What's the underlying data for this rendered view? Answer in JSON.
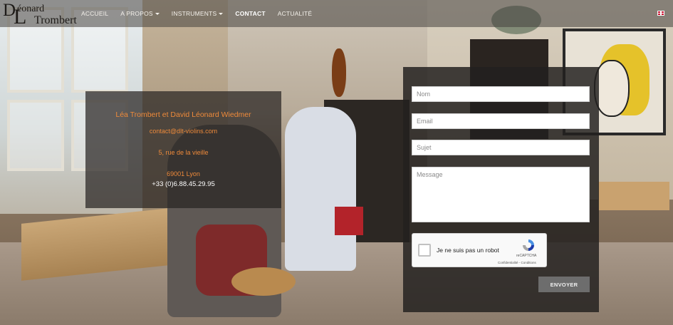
{
  "brand": {
    "logo_initial_d": "D",
    "logo_initial_l": "L",
    "logo_word_1": "éonard",
    "logo_word_2": "Trombert"
  },
  "nav": {
    "items": [
      {
        "label": "ACCUEIL",
        "has_dropdown": false,
        "active": false
      },
      {
        "label": "A PROPOS",
        "has_dropdown": true,
        "active": false
      },
      {
        "label": "INSTRUMENTS",
        "has_dropdown": true,
        "active": false
      },
      {
        "label": "CONTACT",
        "has_dropdown": false,
        "active": true
      },
      {
        "label": "ACTUALITÉ",
        "has_dropdown": false,
        "active": false
      }
    ],
    "language_icon": "uk-flag-icon"
  },
  "contact_info": {
    "names": "Léa Trombert et David Léonard  Wiedmer",
    "email": "contact@dlt-violins.com",
    "street": "5, rue de la vieille",
    "city": "69001 Lyon",
    "phone": "+33 (0)6.88.45.29.95"
  },
  "form": {
    "name_placeholder": "Nom",
    "email_placeholder": "Email",
    "subject_placeholder": "Sujet",
    "message_placeholder": "Message",
    "captcha_label": "Je ne suis pas un robot",
    "captcha_brand": "reCAPTCHA",
    "captcha_terms": "Confidentialité - Conditions",
    "submit_label": "ENVOYER"
  },
  "colors": {
    "accent_orange": "#ee8a3a",
    "panel_dark": "#222020",
    "button_grey": "#6d6d6d"
  }
}
